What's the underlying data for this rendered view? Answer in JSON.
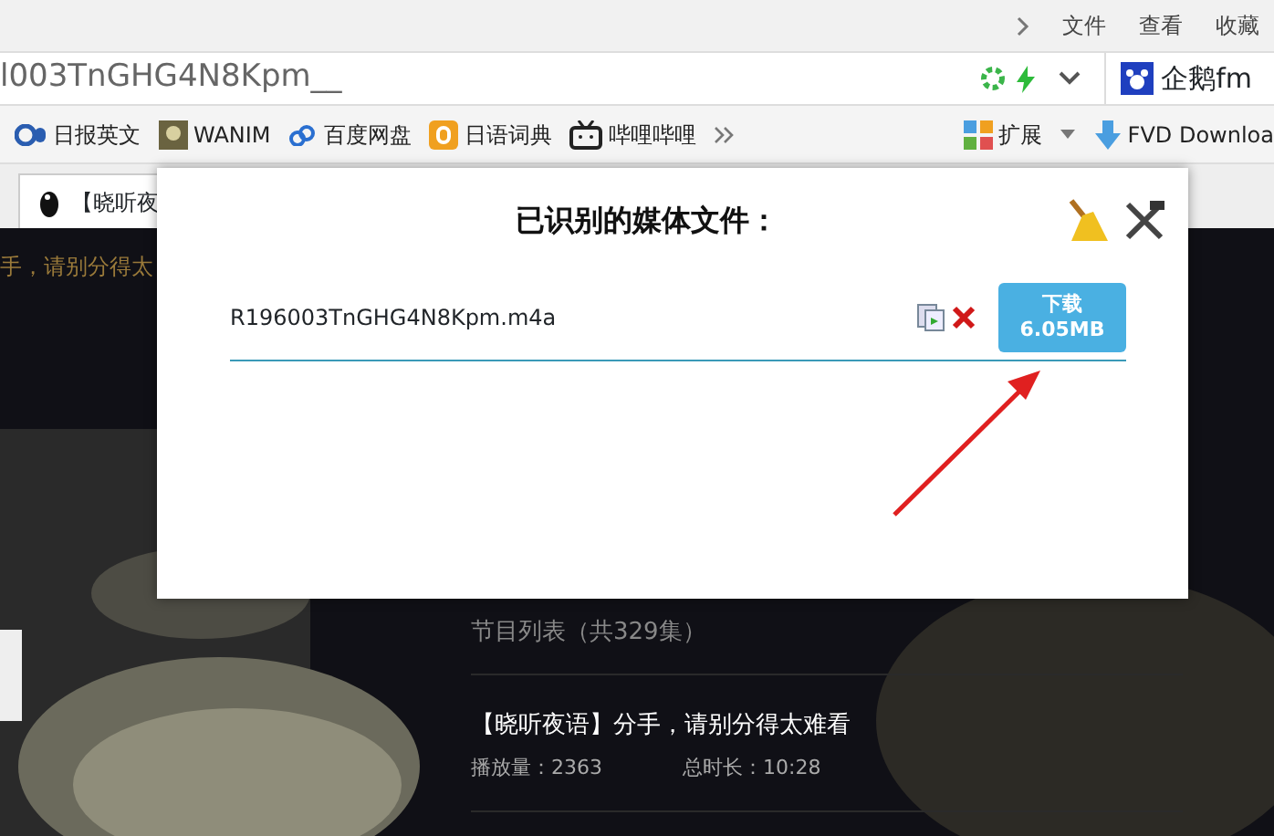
{
  "menu": [
    "文件",
    "查看",
    "收藏"
  ],
  "address": {
    "url": "l003TnGHG4N8Kpm__",
    "search_engine": "企鹅fm"
  },
  "bookmarks": [
    {
      "label": "日报英文"
    },
    {
      "label": "WANIM"
    },
    {
      "label": "百度网盘"
    },
    {
      "label": "日语词典"
    },
    {
      "label": "哔哩哔哩"
    }
  ],
  "toolbar": [
    {
      "label": "扩展"
    },
    {
      "label": "FVD Downloa"
    }
  ],
  "tab": {
    "title": "【晓听夜"
  },
  "page": {
    "headline_fragment": "手，请别分得太",
    "list_heading": "节目列表（共329集）",
    "episodes": [
      {
        "title": "【晓听夜语】分手，请别分得太难看",
        "plays": "播放量：2363",
        "duration": "总时长：10:28"
      }
    ]
  },
  "popup": {
    "title": "已识别的媒体文件：",
    "files": [
      {
        "name": "R196003TnGHG4N8Kpm.m4a",
        "button": "下载",
        "size": "6.05MB"
      }
    ]
  }
}
